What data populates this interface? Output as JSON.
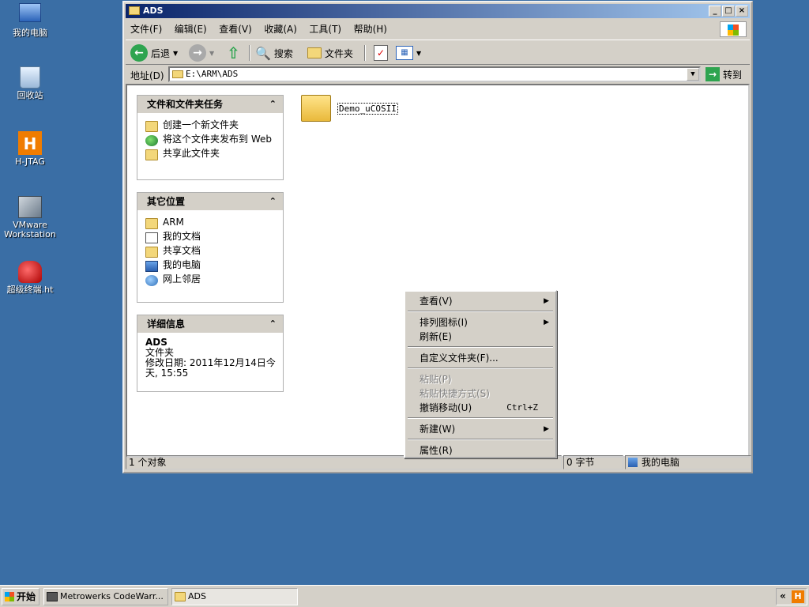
{
  "desktop": {
    "icons": [
      {
        "label": "我的电脑",
        "icon": "my-computer-icon"
      },
      {
        "label": "回收站",
        "icon": "recycle-bin-icon"
      },
      {
        "label": "H-JTAG",
        "icon": "hjtag-icon"
      },
      {
        "label": "VMware Workstation",
        "icon": "vmware-icon"
      },
      {
        "label": "超级终端.ht",
        "icon": "hyperterminal-icon"
      }
    ]
  },
  "window": {
    "title": "ADS",
    "menu": [
      "文件(F)",
      "编辑(E)",
      "查看(V)",
      "收藏(A)",
      "工具(T)",
      "帮助(H)"
    ],
    "toolbar": {
      "back": "后退",
      "search": "搜索",
      "folders": "文件夹"
    },
    "address": {
      "label": "地址(D)",
      "value": "E:\\ARM\\ADS",
      "go": "转到"
    },
    "tasks_panel": {
      "title": "文件和文件夹任务",
      "items": [
        "创建一个新文件夹",
        "将这个文件夹发布到 Web",
        "共享此文件夹"
      ]
    },
    "places_panel": {
      "title": "其它位置",
      "items": [
        "ARM",
        "我的文档",
        "共享文档",
        "我的电脑",
        "网上邻居"
      ]
    },
    "details_panel": {
      "title": "详细信息",
      "name": "ADS",
      "type": "文件夹",
      "modified": "修改日期: 2011年12月14日今天, 15:55"
    },
    "files": [
      {
        "name": "Demo_uCOSII"
      }
    ],
    "status": {
      "objects": "1 个对象",
      "size": "0 字节",
      "location": "我的电脑"
    }
  },
  "context_menu": {
    "view": "查看(V)",
    "arrange": "排列图标(I)",
    "refresh": "刷新(E)",
    "customize": "自定义文件夹(F)...",
    "paste": "粘贴(P)",
    "paste_shortcut": "粘贴快捷方式(S)",
    "undo": "撤销移动(U)",
    "undo_shortcut": "Ctrl+Z",
    "new": "新建(W)",
    "properties": "属性(R)"
  },
  "taskbar": {
    "start": "开始",
    "tasks": [
      "Metrowerks CodeWarr...",
      "ADS"
    ],
    "tray_chevron": "«",
    "tray_icon_letter": "H"
  }
}
